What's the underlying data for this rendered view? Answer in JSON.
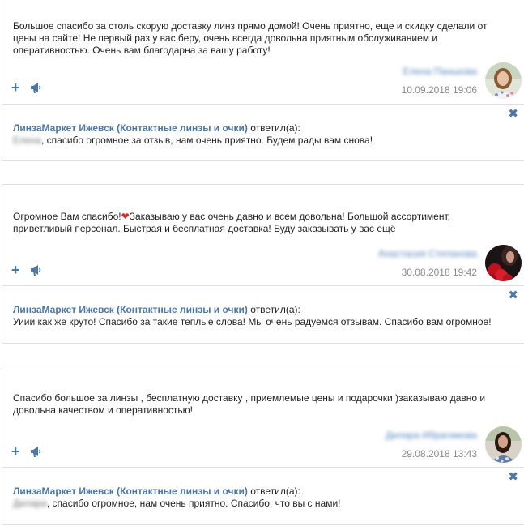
{
  "reviews": [
    {
      "text": "Большое спасибо за столь скорую доставку линз прямо домой! Очень приятно, еще и скидку сделали от цены на сайте! Не первый раз у вас беру, очень всегда довольна приятным обслуживанием и оперативностью. Очень вам благодарна за вашу работу!",
      "author": "Елена Панькова",
      "date": "10.09.2018 19:06",
      "reply": {
        "shop": "ЛинзаМаркет Ижевск (Контактные линзы и очки)",
        "answered": " ответил(а):",
        "name": "Елена",
        "text": ", спасибо огромное за отзыв, нам очень приятно. Будем рады вам снова!"
      }
    },
    {
      "text_before_heart": "Огромное Вам спасибо!",
      "heart": "❤",
      "text_after_heart": "Заказываю у вас очень давно и всем довольна! Большой ассортимент, приветливый персонал. Быстрая и бесплатная доставка! Буду заказывать у вас ещё",
      "author": "Анастасия Степанова",
      "date": "30.08.2018 19:42",
      "reply": {
        "shop": "ЛинзаМаркет Ижевск (Контактные линзы и очки)",
        "answered": " ответил(а):",
        "text": "Уиии как же круто! Спасибо за такие теплые слова! Мы очень радуемся отзывам. Спасибо вам огромное!"
      }
    },
    {
      "text": "Спасибо большое за линзы , бесплатную доставку , приемлемые цены и подарочки )заказываю давно и довольна качеством и оперативностью!",
      "author": "Дилара Ибрагимова",
      "date": "29.08.2018 13:43",
      "reply": {
        "shop": "ЛинзаМаркет Ижевск (Контактные линзы и очки)",
        "answered": " ответил(а):",
        "name": "Дилара",
        "text": ", спасибо огромное, нам очень приятно. Спасибо, что вы с нами!"
      }
    }
  ],
  "icons": {
    "plus": "+",
    "close": "✖",
    "accent": "#4a76a8"
  }
}
